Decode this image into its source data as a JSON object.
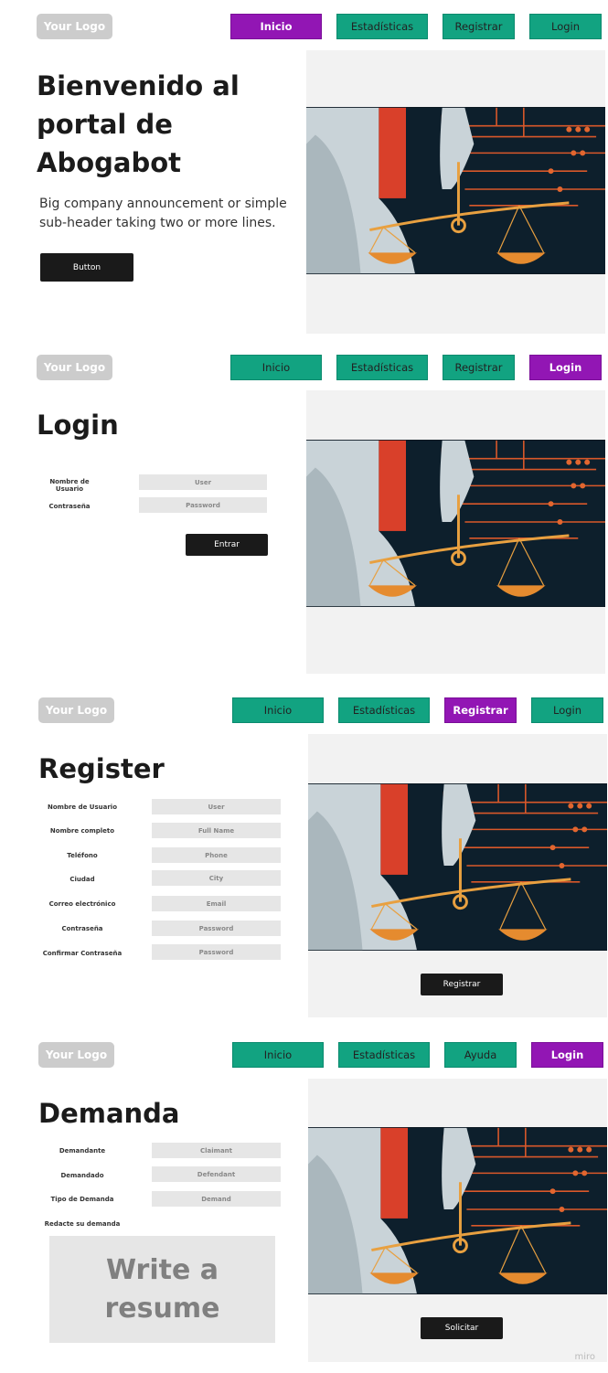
{
  "colors": {
    "nav_green": "#12a381",
    "nav_active": "#9216b4",
    "logo_bg": "#cccccc",
    "panel_bg": "#f2f2f2",
    "button_bg": "#1a1a1a"
  },
  "icons": {
    "hero_art": "justice-statue-scales-circuit-illustration"
  },
  "frame1": {
    "logo": "Your Logo",
    "nav": [
      "Inicio",
      "Estadísticas",
      "Registrar",
      "Login"
    ],
    "active_nav": "Inicio",
    "title": "Bienvenido al portal de Abogabot",
    "subtitle": "Big company announcement or simple sub-header taking two or more lines.",
    "button": "Button"
  },
  "frame2": {
    "logo": "Your Logo",
    "nav": [
      "Inicio",
      "Estadísticas",
      "Registrar",
      "Login"
    ],
    "active_nav": "Login",
    "title": "Login",
    "fields": [
      {
        "label": "Nombre de Usuario",
        "placeholder": "User"
      },
      {
        "label": "Contraseña",
        "placeholder": "Password"
      }
    ],
    "button": "Entrar"
  },
  "frame3": {
    "logo": "Your Logo",
    "nav": [
      "Inicio",
      "Estadísticas",
      "Registrar",
      "Login"
    ],
    "active_nav": "Registrar",
    "title": "Register",
    "fields": [
      {
        "label": "Nombre de Usuario",
        "placeholder": "User"
      },
      {
        "label": "Nombre completo",
        "placeholder": "Full Name"
      },
      {
        "label": "Teléfono",
        "placeholder": "Phone"
      },
      {
        "label": "Ciudad",
        "placeholder": "City"
      },
      {
        "label": "Correo electrónico",
        "placeholder": "Email"
      },
      {
        "label": "Contraseña",
        "placeholder": "Password"
      },
      {
        "label": "Confirmar Contraseña",
        "placeholder": "Password"
      }
    ],
    "button": "Registrar"
  },
  "frame4": {
    "logo": "Your Logo",
    "nav": [
      "Inicio",
      "Estadísticas",
      "Ayuda",
      "Login"
    ],
    "active_nav": "Login",
    "title": "Demanda",
    "fields": [
      {
        "label": "Demandante",
        "placeholder": "Claimant"
      },
      {
        "label": "Demandado",
        "placeholder": "Defendant"
      },
      {
        "label": "Tipo de Demanda",
        "placeholder": "Demand"
      }
    ],
    "textarea_label": "Redacte su demanda",
    "textarea_placeholder": "Write a resume",
    "button": "Solicitar"
  },
  "watermark": "miro"
}
